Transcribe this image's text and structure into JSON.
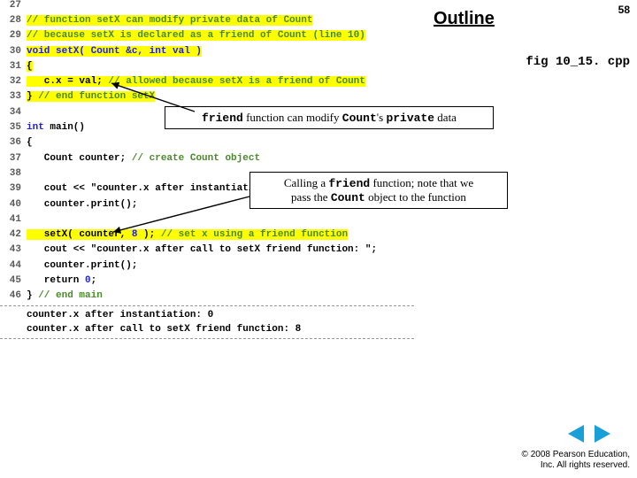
{
  "slide": {
    "number": "58",
    "outline": "Outline",
    "fig": "fig 10_15. cpp"
  },
  "code": [
    {
      "n": "27",
      "cls": "",
      "txt": ""
    },
    {
      "n": "28",
      "cls": "grn",
      "hl": true,
      "txt": "// function setX can modify private data of Count"
    },
    {
      "n": "29",
      "cls": "grn",
      "hl": true,
      "txt": "// because setX is declared as a friend of Count (line 10)"
    },
    {
      "n": "30",
      "cls": "blu",
      "hl": true,
      "txt": "void setX( Count &c, int val )"
    },
    {
      "n": "31",
      "cls": "",
      "hl": true,
      "txt": "{"
    },
    {
      "n": "32",
      "cls": "",
      "hl": true,
      "txt": "   c.x = val; // allowed because setX is a friend of Count",
      "grnTail": "// allowed because setX is a friend of Count"
    },
    {
      "n": "33",
      "cls": "",
      "hl": true,
      "txt": "} // end function setX",
      "grnTail": "// end function setX"
    },
    {
      "n": "34",
      "cls": "",
      "txt": ""
    },
    {
      "n": "35",
      "cls": "",
      "txt": "int main()",
      "bluLead": "int "
    },
    {
      "n": "36",
      "cls": "",
      "txt": "{"
    },
    {
      "n": "37",
      "cls": "",
      "txt": "   Count counter; // create Count object",
      "grnTail": "// create Count object"
    },
    {
      "n": "38",
      "cls": "",
      "txt": ""
    },
    {
      "n": "39",
      "cls": "",
      "txt": "   cout << \"counter.x after instantiation: \";"
    },
    {
      "n": "40",
      "cls": "",
      "txt": "   counter.print();"
    },
    {
      "n": "41",
      "cls": "",
      "txt": ""
    },
    {
      "n": "42",
      "cls": "",
      "hl": true,
      "txt": "   setX( counter, 8 ); // set x using a friend function",
      "grnTail": "// set x using a friend function",
      "blu8": true
    },
    {
      "n": "43",
      "cls": "",
      "txt": "   cout << \"counter.x after call to setX friend function: \";"
    },
    {
      "n": "44",
      "cls": "",
      "txt": "   counter.print();"
    },
    {
      "n": "45",
      "cls": "",
      "txt": "   return 0;",
      "blu0": true
    },
    {
      "n": "46",
      "cls": "",
      "txt": "} // end main",
      "grnTail": "// end main"
    }
  ],
  "output": [
    "counter.x after instantiation: 0",
    "counter.x after call to setX friend function: 8"
  ],
  "callout1": {
    "pre": "friend",
    "mid": " function can modify ",
    "code2": "Count",
    "mid2": "'s ",
    "code3": "private",
    "end": " data"
  },
  "callout2": {
    "l1a": "Calling a ",
    "l1b": "friend",
    "l1c": " function; note that we",
    "l2a": "pass the ",
    "l2b": "Count",
    "l2c": "  object to the function"
  },
  "copyright": {
    "l1": "© 2008 Pearson Education,",
    "l2": "Inc.  All rights reserved."
  }
}
